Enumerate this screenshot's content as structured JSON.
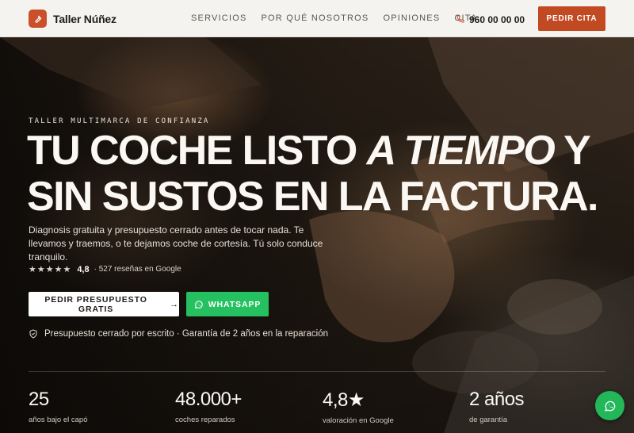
{
  "brand": {
    "name": "Taller Núñez",
    "accent": "#c24a23",
    "logo_icon": "wrench-icon"
  },
  "nav": {
    "items": [
      {
        "label": "SERVICIOS"
      },
      {
        "label": "POR QUÉ NOSOTROS"
      },
      {
        "label": "OPINIONES"
      },
      {
        "label": "CITA"
      }
    ],
    "phone": "960 00 00 00",
    "phone_icon": "phone-icon",
    "cta_label": "PEDIR CITA"
  },
  "hero": {
    "eyebrow": "TALLER MULTIMARCA DE CONFIANZA",
    "headline_part1": "TU COCHE LISTO ",
    "headline_emphasis": "A TIEMPO",
    "headline_part2": " Y SIN SUSTOS EN LA FACTURA.",
    "subtitle": "Diagnosis gratuita y presupuesto cerrado antes de tocar nada. Te llevamos y traemos, o te dejamos coche de cortesía. Tú solo conduce tranquilo.",
    "rating": {
      "stars": "★★★★★",
      "value": "4,8",
      "text": "· 527 reseñas en Google",
      "star_count": 5
    },
    "primary_cta": {
      "label": "PEDIR PRESUPUESTO GRATIS",
      "icon": "arrow-right-icon"
    },
    "whatsapp_cta": {
      "label": "WHATSAPP",
      "icon": "whatsapp-icon",
      "color": "#25c160"
    },
    "guarantee": {
      "icon": "shield-check-icon",
      "text": "Presupuesto cerrado por escrito · Garantía de 2 años en la reparación"
    }
  },
  "stats": [
    {
      "value": "25",
      "label": "años bajo el capó"
    },
    {
      "value": "48.000+",
      "label": "coches reparados"
    },
    {
      "value": "4,8★",
      "label": "valoración en Google"
    },
    {
      "value": "2 años",
      "label": "de garantía"
    }
  ],
  "floating_whatsapp": {
    "icon": "whatsapp-icon",
    "color": "#22b85a"
  }
}
